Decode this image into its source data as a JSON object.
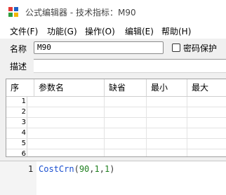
{
  "window": {
    "title": "公式编辑器 - 技术指标：M90"
  },
  "menu": {
    "items": [
      {
        "label": "文件(F)"
      },
      {
        "label": "功能(G)"
      },
      {
        "label": "操作(O)"
      },
      {
        "label": "编辑(E)"
      },
      {
        "label": "帮助(H)"
      }
    ]
  },
  "form": {
    "name_label": "名称",
    "name_value": "M90",
    "password_label": "密码保护",
    "password_checked": false,
    "desc_label": "描述",
    "desc_value": ""
  },
  "params_table": {
    "headers": [
      "序",
      "参数名",
      "缺省",
      "最小",
      "最大"
    ],
    "row_numbers": [
      "1",
      "2",
      "3",
      "4",
      "5",
      "6"
    ]
  },
  "editor": {
    "line_number": "1",
    "tokens": [
      {
        "text": "CostCrn",
        "type": "fn"
      },
      {
        "text": "(",
        "type": "punc"
      },
      {
        "text": "90",
        "type": "num"
      },
      {
        "text": ",",
        "type": "punc"
      },
      {
        "text": "1",
        "type": "num"
      },
      {
        "text": ",",
        "type": "punc"
      },
      {
        "text": "1",
        "type": "num"
      },
      {
        "text": ")",
        "type": "punc"
      }
    ]
  },
  "colors": {
    "function": "#1a4fd0",
    "number": "#208020",
    "icon_red": "#e53935",
    "icon_blue": "#1e63c6",
    "icon_green": "#2e9e3e",
    "icon_yellow": "#f2b705"
  },
  "icons": [
    "app-logo-icon",
    "checkbox-icon"
  ]
}
